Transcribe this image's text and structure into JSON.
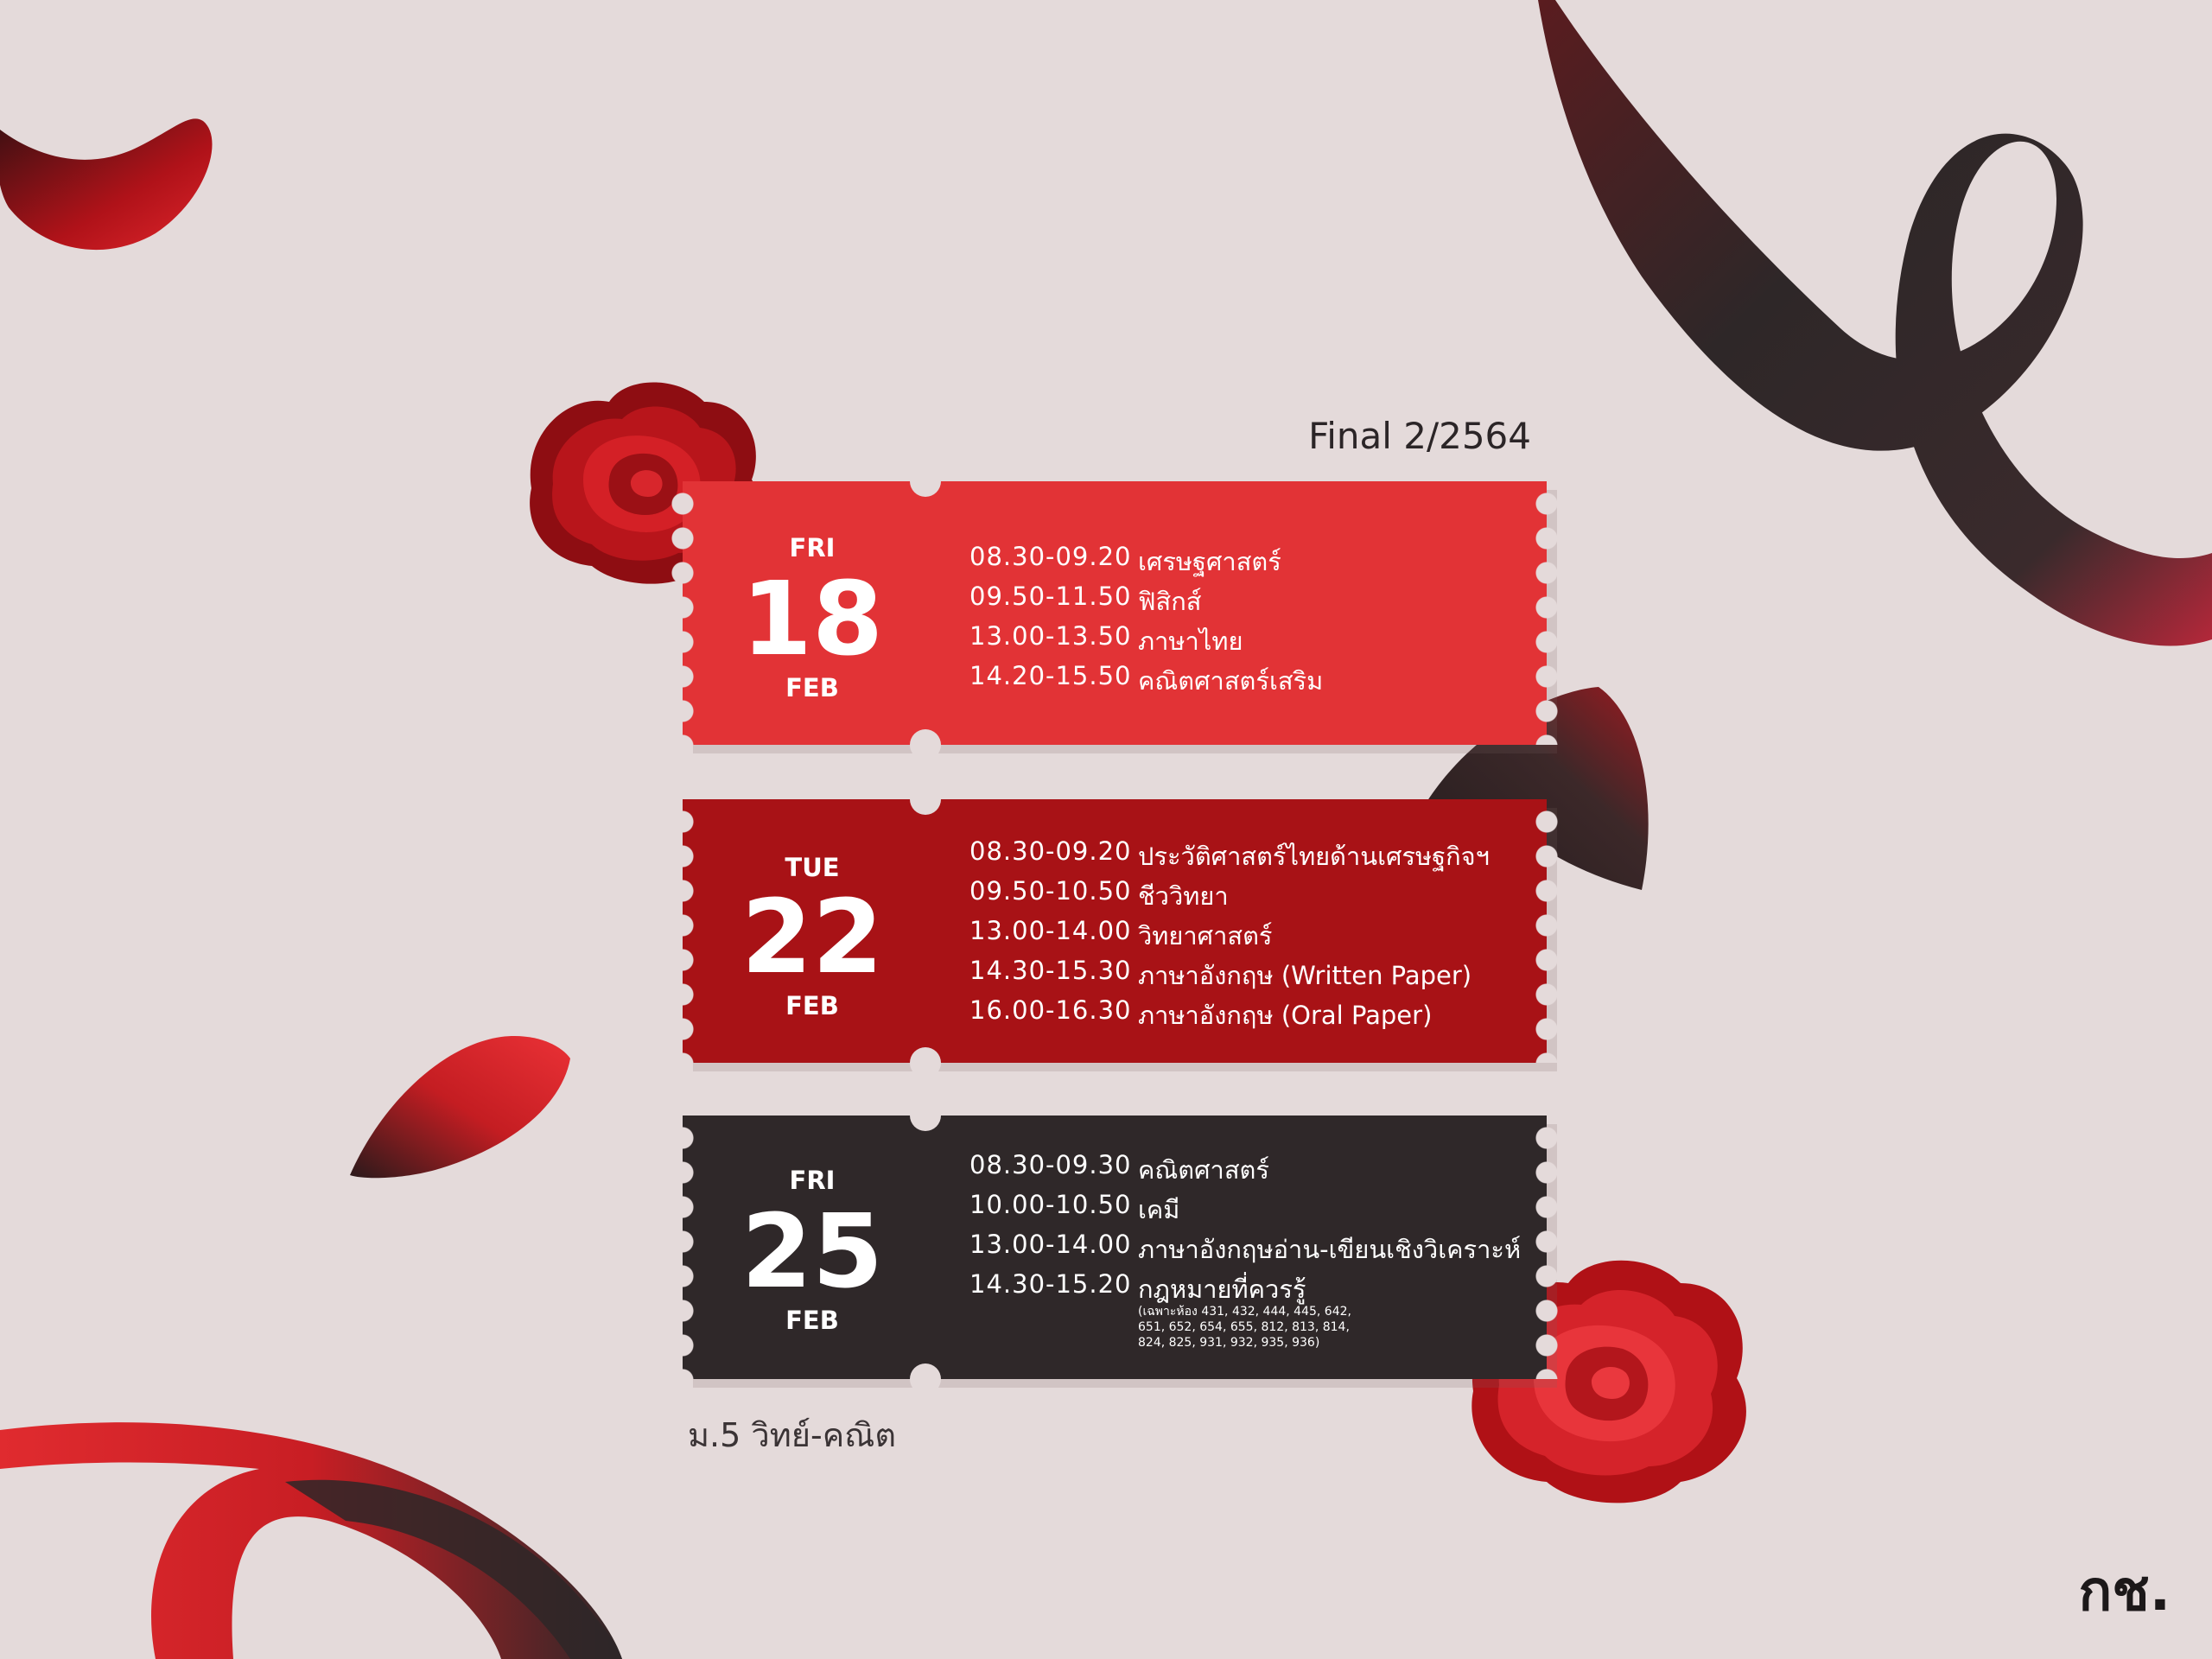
{
  "header": {
    "exam_title": "Final 2/2564"
  },
  "colors": {
    "background": "#e4dada",
    "ticket_1": "#e23336",
    "ticket_2": "#a81216",
    "ticket_3": "#2f2829",
    "rose": "#c8181e",
    "ribbon_dark": "#2e2728"
  },
  "tickets": [
    {
      "day": "FRI",
      "date": "18",
      "month": "FEB",
      "rows": [
        {
          "time": "08.30-09.20",
          "subject": "เศรษฐศาสตร์"
        },
        {
          "time": "09.50-11.50",
          "subject": "ฟิสิกส์"
        },
        {
          "time": "13.00-13.50",
          "subject": "ภาษาไทย"
        },
        {
          "time": "14.20-15.50",
          "subject": "คณิตศาสตร์เสริม"
        }
      ]
    },
    {
      "day": "TUE",
      "date": "22",
      "month": "FEB",
      "rows": [
        {
          "time": "08.30-09.20",
          "subject": "ประวัติศาสตร์ไทยด้านเศรษฐกิจฯ"
        },
        {
          "time": "09.50-10.50",
          "subject": "ชีววิทยา"
        },
        {
          "time": "13.00-14.00",
          "subject": "วิทยาศาสตร์"
        },
        {
          "time": "14.30-15.30",
          "subject": "ภาษาอังกฤษ (Written Paper)"
        },
        {
          "time": "16.00-16.30",
          "subject": "ภาษาอังกฤษ (Oral Paper)"
        }
      ]
    },
    {
      "day": "FRI",
      "date": "25",
      "month": "FEB",
      "rows": [
        {
          "time": "08.30-09.30",
          "subject": "คณิตศาสตร์"
        },
        {
          "time": "10.00-10.50",
          "subject": "เคมี"
        },
        {
          "time": "13.00-14.00",
          "subject": "ภาษาอังกฤษอ่าน-เขียนเชิงวิเคราะห์"
        },
        {
          "time": "14.30-15.20",
          "subject": "กฎหมายที่ควรรู้"
        }
      ],
      "note_lines": [
        "(เฉพาะห้อง 431, 432, 444, 445, 642,",
        "651, 652, 654, 655, 812, 813, 814,",
        "824, 825, 931, 932, 935, 936)"
      ]
    }
  ],
  "footer": {
    "grade_label": "ม.5 วิทย์-คณิต",
    "logo_text": "กช."
  }
}
